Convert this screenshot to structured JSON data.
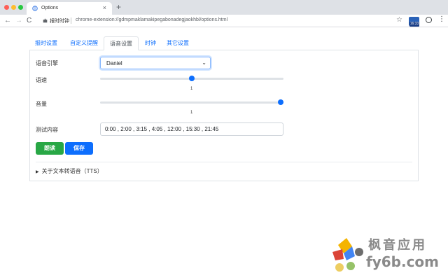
{
  "browser": {
    "tab_title": "Options",
    "tab_close": "×",
    "new_tab": "+",
    "back": "←",
    "forward": "→",
    "reload": "C",
    "omnibox_label": "报时时钟",
    "url": "chrome-extension://gdmpmaklamakipegabonadegjaokhbl/options.html",
    "star": "☆",
    "extension_badge": "16:33",
    "menu": "⋮"
  },
  "tabs": [
    {
      "label": "报时设置",
      "active": false
    },
    {
      "label": "自定义提醒",
      "active": false
    },
    {
      "label": "语音设置",
      "active": true
    },
    {
      "label": "时钟",
      "active": false
    },
    {
      "label": "其它设置",
      "active": false
    }
  ],
  "form": {
    "engine_label": "语音引擎",
    "engine_value": "Daniel",
    "rate_label": "语速",
    "rate_value": "1",
    "rate_fraction": 0.5,
    "volume_label": "音量",
    "volume_value": "1",
    "volume_fraction": 1.0,
    "test_label": "测试内容",
    "test_value": "0:00 , 2:00 , 3:15 , 4:05 , 12:00 , 15:30 , 21:45"
  },
  "buttons": {
    "read": "朗读",
    "save": "保存"
  },
  "details": {
    "caret": "▶",
    "summary": "关于文本转语音（TTS）"
  },
  "watermark": {
    "line1": "枫音应用",
    "line2": "fy6b.com"
  },
  "colors": {
    "accent": "#0d6efd",
    "success": "#28a745"
  }
}
